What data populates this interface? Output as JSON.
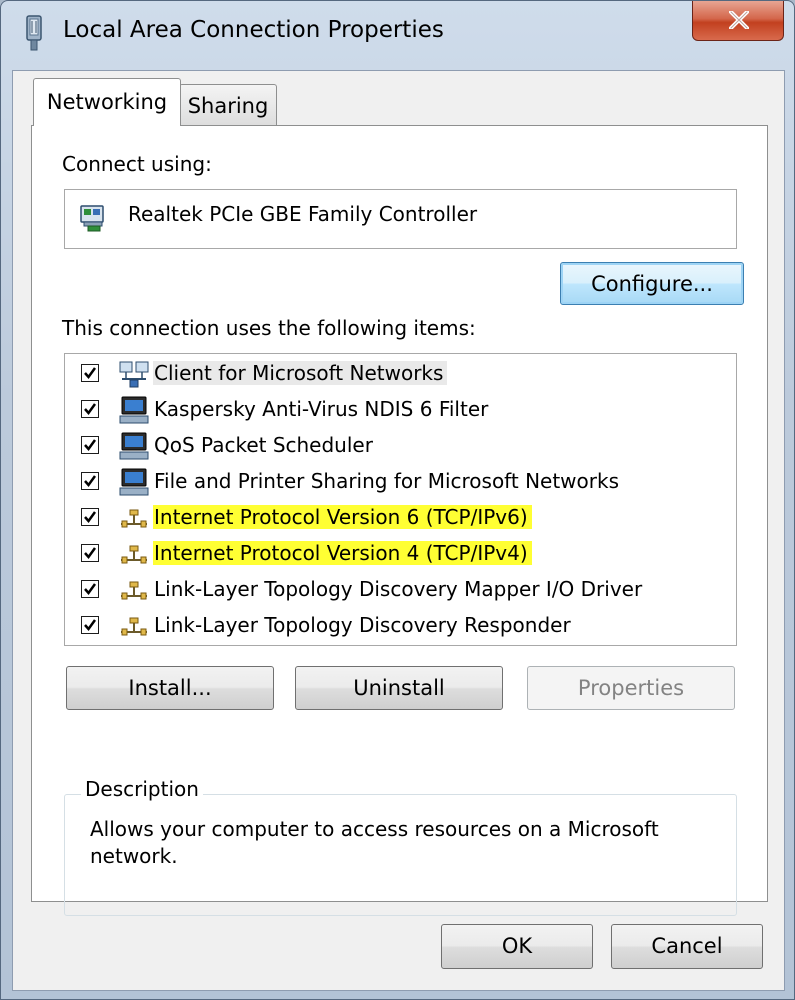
{
  "window": {
    "title": "Local Area Connection Properties",
    "close_symbol": "✕"
  },
  "tabs": [
    {
      "label": "Networking",
      "active": true
    },
    {
      "label": "Sharing",
      "active": false
    }
  ],
  "connect_using": {
    "label": "Connect using:",
    "adapter_name": "Realtek PCIe GBE Family Controller",
    "adapter_icon": "network-adapter-icon"
  },
  "configure_label": "Configure...",
  "items_label": "This connection uses the following items:",
  "items": [
    {
      "label": "Client for Microsoft Networks",
      "checked": true,
      "icon": "client-network-icon",
      "selected": true
    },
    {
      "label": "Kaspersky Anti-Virus NDIS 6 Filter",
      "checked": true,
      "icon": "service-computer-icon"
    },
    {
      "label": "QoS Packet Scheduler",
      "checked": true,
      "icon": "service-computer-icon"
    },
    {
      "label": "File and Printer Sharing for Microsoft Networks",
      "checked": true,
      "icon": "service-computer-icon"
    },
    {
      "label": "Internet Protocol Version 6 (TCP/IPv6)",
      "checked": true,
      "icon": "protocol-icon",
      "highlighted": true
    },
    {
      "label": "Internet Protocol Version 4 (TCP/IPv4)",
      "checked": true,
      "icon": "protocol-icon",
      "highlighted": true
    },
    {
      "label": "Link-Layer Topology Discovery Mapper I/O Driver",
      "checked": true,
      "icon": "protocol-icon"
    },
    {
      "label": "Link-Layer Topology Discovery Responder",
      "checked": true,
      "icon": "protocol-icon"
    }
  ],
  "buttons": {
    "install": "Install...",
    "uninstall": "Uninstall",
    "properties": "Properties",
    "ok": "OK",
    "cancel": "Cancel"
  },
  "description": {
    "legend": "Description",
    "text": "Allows your computer to access resources on a Microsoft network."
  },
  "colors": {
    "highlight": "#ffff33",
    "close_button": "#c2401f",
    "default_button_border": "#3c7fb1"
  }
}
